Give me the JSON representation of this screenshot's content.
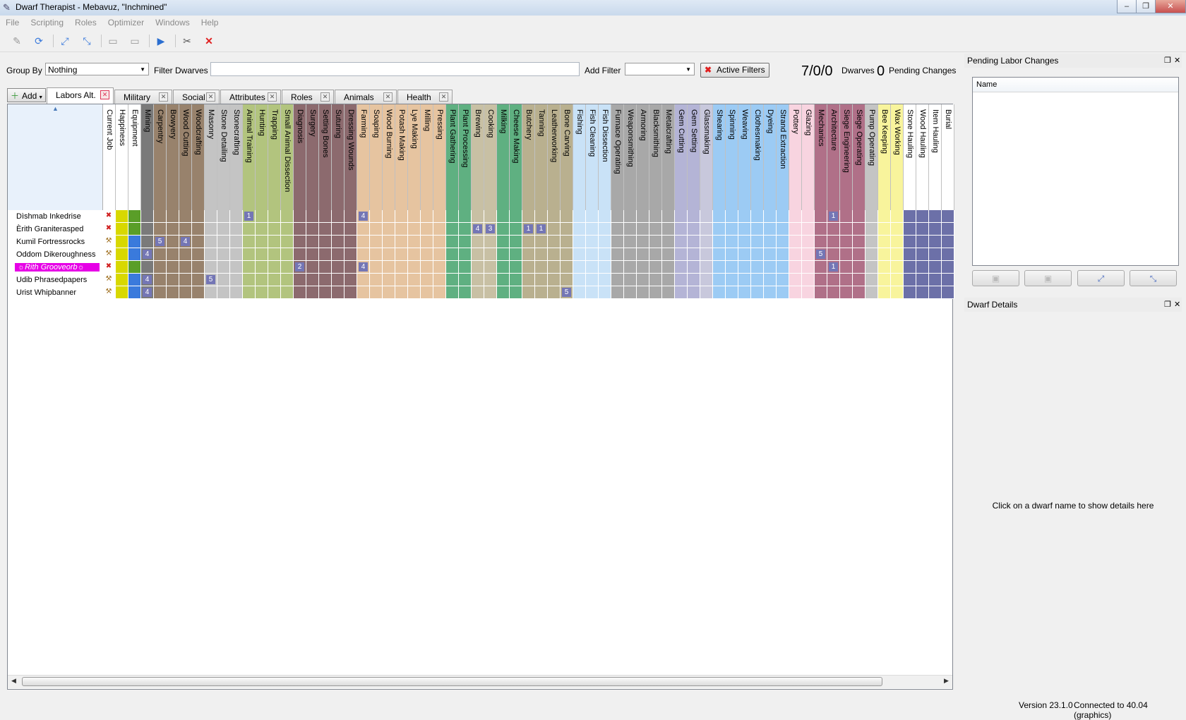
{
  "window": {
    "title": "Dwarf Therapist -  Mebavuz, \"Inchmined\""
  },
  "menu": [
    "File",
    "Scripting",
    "Roles",
    "Optimizer",
    "Windows",
    "Help"
  ],
  "filterbar": {
    "group_by_label": "Group By",
    "group_by_value": "Nothing",
    "filter_label": "Filter Dwarves",
    "filter_value": "",
    "add_filter_label": "Add Filter",
    "add_filter_value": "",
    "active_filters_label": "Active Filters",
    "dwarf_count": "7/0/0",
    "dwarves_label": "Dwarves",
    "pending_count": "0",
    "pending_label": "Pending Changes"
  },
  "add_button_label": "Add",
  "tabs": [
    {
      "label": "Labors Alt.",
      "active": true
    },
    {
      "label": "Military",
      "active": false
    },
    {
      "label": "Social",
      "active": false
    },
    {
      "label": "Attributes",
      "active": false
    },
    {
      "label": "Roles",
      "active": false
    },
    {
      "label": "Animals",
      "active": false
    },
    {
      "label": "Health",
      "active": false
    }
  ],
  "grid": {
    "columns": [
      {
        "label": "Current Job",
        "color": "#ffffff"
      },
      {
        "label": "Happiness",
        "color": "#ffffff"
      },
      {
        "label": "Equipment",
        "color": "#ffffff"
      },
      {
        "label": "Mining",
        "color": "#7a7a7a"
      },
      {
        "label": "Carpentry",
        "color": "#98826c"
      },
      {
        "label": "Bowyery",
        "color": "#98826c"
      },
      {
        "label": "Wood Cutting",
        "color": "#98826c"
      },
      {
        "label": "Woodcrafting",
        "color": "#98826c"
      },
      {
        "label": "Masonry",
        "color": "#c4c4c4"
      },
      {
        "label": "Stone Detailing",
        "color": "#c4c4c4"
      },
      {
        "label": "Stonecrafting",
        "color": "#c4c4c4"
      },
      {
        "label": "Animal Training",
        "color": "#b2c47e"
      },
      {
        "label": "Hunting",
        "color": "#b2c47e"
      },
      {
        "label": "Trapping",
        "color": "#b2c47e"
      },
      {
        "label": "Small Animal Dissection",
        "color": "#b2c47e"
      },
      {
        "label": "Diagnosis",
        "color": "#8c6a6e"
      },
      {
        "label": "Surgery",
        "color": "#8c6a6e"
      },
      {
        "label": "Setting Bones",
        "color": "#8c6a6e"
      },
      {
        "label": "Suturing",
        "color": "#8c6a6e"
      },
      {
        "label": "Dressing Wounds",
        "color": "#8c6a6e"
      },
      {
        "label": "Farming",
        "color": "#e6c4a0"
      },
      {
        "label": "Soaping",
        "color": "#e6c4a0"
      },
      {
        "label": "Wood Burning",
        "color": "#e6c4a0"
      },
      {
        "label": "Potash Making",
        "color": "#e6c4a0"
      },
      {
        "label": "Lye Making",
        "color": "#e6c4a0"
      },
      {
        "label": "Milling",
        "color": "#e6c4a0"
      },
      {
        "label": "Pressing",
        "color": "#e6c4a0"
      },
      {
        "label": "Plant Gathering",
        "color": "#5fb081"
      },
      {
        "label": "Plant Processing",
        "color": "#5fb081"
      },
      {
        "label": "Brewing",
        "color": "#c8c0a4"
      },
      {
        "label": "Cooking",
        "color": "#c8c0a4"
      },
      {
        "label": "Milking",
        "color": "#5fb081"
      },
      {
        "label": "Cheese Making",
        "color": "#5fb081"
      },
      {
        "label": "Butchery",
        "color": "#b9b08f"
      },
      {
        "label": "Tanning",
        "color": "#b9b08f"
      },
      {
        "label": "Leatherworking",
        "color": "#b9b08f"
      },
      {
        "label": "Bone Carving",
        "color": "#b9b08f"
      },
      {
        "label": "Fishing",
        "color": "#c9e2f7"
      },
      {
        "label": "Fish Cleaning",
        "color": "#c9e2f7"
      },
      {
        "label": "Fish Dissection",
        "color": "#c9e2f7"
      },
      {
        "label": "Furnace Operating",
        "color": "#a8a8a8"
      },
      {
        "label": "Weaponsmithing",
        "color": "#a8a8a8"
      },
      {
        "label": "Armoring",
        "color": "#a8a8a8"
      },
      {
        "label": "Blacksmithing",
        "color": "#a8a8a8"
      },
      {
        "label": "Metalcrafting",
        "color": "#a8a8a8"
      },
      {
        "label": "Gem Cutting",
        "color": "#b4b4d6"
      },
      {
        "label": "Gem Setting",
        "color": "#b4b4d6"
      },
      {
        "label": "Glassmaking",
        "color": "#c8c8dc"
      },
      {
        "label": "Shearing",
        "color": "#9ccbf4"
      },
      {
        "label": "Spinning",
        "color": "#9ccbf4"
      },
      {
        "label": "Weaving",
        "color": "#9ccbf4"
      },
      {
        "label": "Clothesmaking",
        "color": "#9ccbf4"
      },
      {
        "label": "Dyeing",
        "color": "#9ccbf4"
      },
      {
        "label": "Strand Extraction",
        "color": "#9ccbf4"
      },
      {
        "label": "Pottery",
        "color": "#f8d4e0"
      },
      {
        "label": "Glazing",
        "color": "#f8d4e0"
      },
      {
        "label": "Mechanics",
        "color": "#b07088"
      },
      {
        "label": "Architecture",
        "color": "#b07088"
      },
      {
        "label": "Siege Engineering",
        "color": "#b07088"
      },
      {
        "label": "Siege Operating",
        "color": "#b07088"
      },
      {
        "label": "Pump Operating",
        "color": "#c4c4c4"
      },
      {
        "label": "Bee Keeping",
        "color": "#f8f49c"
      },
      {
        "label": "Wax Working",
        "color": "#f8f49c"
      },
      {
        "label": "Stone Hauling",
        "color": "#ffffff"
      },
      {
        "label": "Wood Hauling",
        "color": "#ffffff"
      },
      {
        "label": "Item Hauling",
        "color": "#ffffff"
      },
      {
        "label": "Burial",
        "color": "#ffffff"
      }
    ],
    "rows": [
      {
        "name": "Dìshmab Inkedrise",
        "job": "x",
        "happiness_color": "#d8d800",
        "equipment_color": "#5a9e28",
        "highlight": false,
        "badges": [
          {
            "col": "Animal Training",
            "value": "1"
          },
          {
            "col": "Farming",
            "value": "4"
          },
          {
            "col": "Architecture",
            "value": "1"
          }
        ]
      },
      {
        "name": "Èrith Graniterasped",
        "job": "x",
        "happiness_color": "#d8d800",
        "equipment_color": "#5a9e28",
        "highlight": false,
        "badges": [
          {
            "col": "Brewing",
            "value": "4"
          },
          {
            "col": "Cooking",
            "value": "3"
          },
          {
            "col": "Butchery",
            "value": "1"
          },
          {
            "col": "Tanning",
            "value": "1"
          }
        ]
      },
      {
        "name": "Kumil Fortressrocks",
        "job": "tool",
        "happiness_color": "#d8d800",
        "equipment_color": "#3a7adc",
        "highlight": false,
        "badges": [
          {
            "col": "Carpentry",
            "value": "5"
          },
          {
            "col": "Wood Cutting",
            "value": "4"
          }
        ]
      },
      {
        "name": "Oddom Dikeroughness",
        "job": "tool",
        "happiness_color": "#d8d800",
        "equipment_color": "#3a7adc",
        "highlight": false,
        "badges": [
          {
            "col": "Mining",
            "value": "4"
          },
          {
            "col": "Mechanics",
            "value": "5"
          }
        ]
      },
      {
        "name": "☼Rith Grooveorb☼",
        "job": "x",
        "happiness_color": "#d8d800",
        "equipment_color": "#5a9e28",
        "highlight": true,
        "badges": [
          {
            "col": "Diagnosis",
            "value": "2"
          },
          {
            "col": "Farming",
            "value": "4"
          },
          {
            "col": "Architecture",
            "value": "1"
          }
        ]
      },
      {
        "name": "Udib Phrasedpapers",
        "job": "tool",
        "happiness_color": "#d8d800",
        "equipment_color": "#3a7adc",
        "highlight": false,
        "badges": [
          {
            "col": "Mining",
            "value": "4"
          },
          {
            "col": "Masonry",
            "value": "5"
          }
        ]
      },
      {
        "name": "Urist Whipbanner",
        "job": "tool",
        "happiness_color": "#d8d800",
        "equipment_color": "#3a7adc",
        "highlight": false,
        "badges": [
          {
            "col": "Mining",
            "value": "4"
          },
          {
            "col": "Bone Carving",
            "value": "5"
          }
        ]
      }
    ]
  },
  "pending_panel": {
    "title": "Pending Labor Changes",
    "column_name": "Name"
  },
  "details_panel": {
    "title": "Dwarf Details",
    "message": "Click on a dwarf name to show details here"
  },
  "status": {
    "version": "Version 23.1.0",
    "connection": "Connected to 40.04 (graphics)"
  }
}
